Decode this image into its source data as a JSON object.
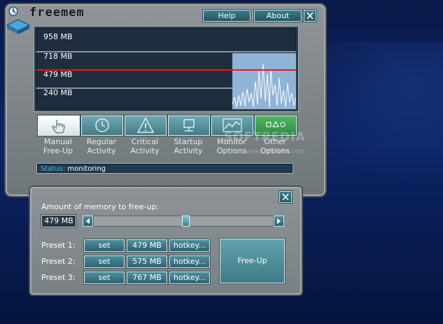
{
  "app": {
    "title": "freemem"
  },
  "toolbar": {
    "help_label": "Help",
    "about_label": "About"
  },
  "graph": {
    "labels": [
      "958 MB",
      "718 MB",
      "479 MB",
      "240 MB"
    ],
    "threshold_label": "479 MB",
    "colors": {
      "background": "#1f2e3e",
      "line": "#ffffff",
      "threshold": "#ff1010",
      "fill": "#8fb4d8"
    }
  },
  "actions": [
    {
      "line1": "Manual",
      "line2": "Free-Up",
      "icon": "hand-cursor-icon"
    },
    {
      "line1": "Regular",
      "line2": "Activity",
      "icon": "clock-icon"
    },
    {
      "line1": "Critical",
      "line2": "Activity",
      "icon": "warning-icon"
    },
    {
      "line1": "Startup",
      "line2": "Activity",
      "icon": "monitor-icon"
    },
    {
      "line1": "Monitor",
      "line2": "Options",
      "icon": "chart-icon"
    },
    {
      "line1": "Other",
      "line2": "Options",
      "icon": "shapes-icon"
    }
  ],
  "status": {
    "key": "Status:",
    "value": "monitoring"
  },
  "freeup": {
    "title": "Amount of memory to free-up:",
    "current_value": "479 MB",
    "presets": [
      {
        "label": "Preset 1:",
        "set_label": "set",
        "value": "479 MB",
        "hotkey_label": "hotkey..."
      },
      {
        "label": "Preset 2:",
        "set_label": "set",
        "value": "575 MB",
        "hotkey_label": "hotkey..."
      },
      {
        "label": "Preset 3:",
        "set_label": "set",
        "value": "767 MB",
        "hotkey_label": "hotkey..."
      }
    ],
    "freeup_label": "Free-Up"
  },
  "watermark": {
    "text": "SOFTPEDIA",
    "url": "www.softpedia.com"
  }
}
